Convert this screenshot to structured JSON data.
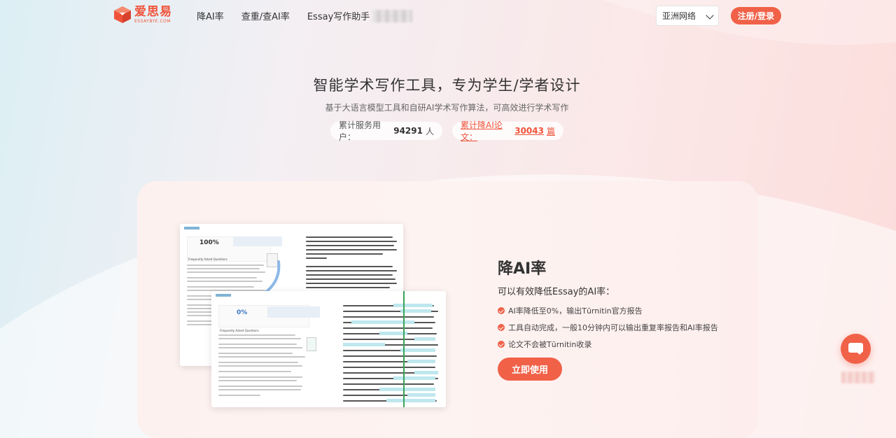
{
  "header": {
    "logo_cn": "爱思易",
    "logo_en": "ESSAYBYE.COM",
    "nav": [
      "降AI率",
      "查重/查AI率",
      "Essay写作助手"
    ],
    "region_select": "亚洲网络",
    "login_button": "注册/登录"
  },
  "hero": {
    "title": "智能学术写作工具，专为学生/学者设计",
    "subtitle": "基于大语言模型工具和自研AI学术写作算法，可高效进行学术写作",
    "stats": [
      {
        "label": "累计服务用户：",
        "value": "94291",
        "unit": "人"
      },
      {
        "label": "累计降AI论文：",
        "value": "30043",
        "unit": "篇"
      }
    ]
  },
  "feature": {
    "title": "降AI率",
    "description": "可以有效降低Essay的AI率：",
    "points": [
      "AI率降低至0%，输出Tūrnitin官方报告",
      "工具自动完成，一般10分钟内可以输出重复率报告和AI率报告",
      "论文不会被Tūrnitin收录"
    ],
    "cta": "立即使用",
    "preview": {
      "before_score": "100%",
      "after_score": "0%",
      "heading": "Frequently Asked Questions"
    }
  },
  "colors": {
    "accent": "#f06148",
    "highlight": "#bfe7ee"
  },
  "icons": [
    "logo-cube-icon",
    "chevron-down-icon",
    "check-circle-icon",
    "chat-icon",
    "curved-arrow-icon"
  ]
}
